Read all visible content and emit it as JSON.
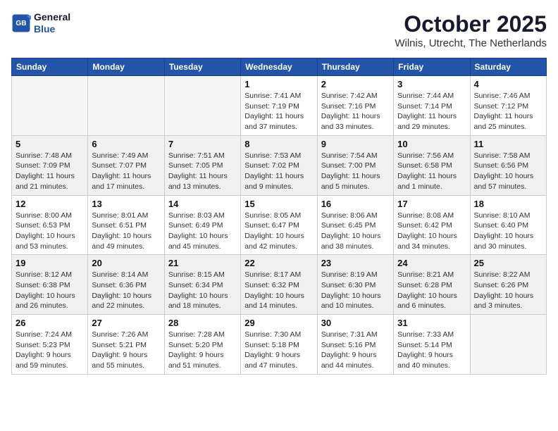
{
  "header": {
    "logo": {
      "line1": "General",
      "line2": "Blue"
    },
    "title": "October 2025",
    "location": "Wilnis, Utrecht, The Netherlands"
  },
  "weekdays": [
    "Sunday",
    "Monday",
    "Tuesday",
    "Wednesday",
    "Thursday",
    "Friday",
    "Saturday"
  ],
  "weeks": [
    [
      {
        "day": "",
        "info": ""
      },
      {
        "day": "",
        "info": ""
      },
      {
        "day": "",
        "info": ""
      },
      {
        "day": "1",
        "info": "Sunrise: 7:41 AM\nSunset: 7:19 PM\nDaylight: 11 hours\nand 37 minutes."
      },
      {
        "day": "2",
        "info": "Sunrise: 7:42 AM\nSunset: 7:16 PM\nDaylight: 11 hours\nand 33 minutes."
      },
      {
        "day": "3",
        "info": "Sunrise: 7:44 AM\nSunset: 7:14 PM\nDaylight: 11 hours\nand 29 minutes."
      },
      {
        "day": "4",
        "info": "Sunrise: 7:46 AM\nSunset: 7:12 PM\nDaylight: 11 hours\nand 25 minutes."
      }
    ],
    [
      {
        "day": "5",
        "info": "Sunrise: 7:48 AM\nSunset: 7:09 PM\nDaylight: 11 hours\nand 21 minutes."
      },
      {
        "day": "6",
        "info": "Sunrise: 7:49 AM\nSunset: 7:07 PM\nDaylight: 11 hours\nand 17 minutes."
      },
      {
        "day": "7",
        "info": "Sunrise: 7:51 AM\nSunset: 7:05 PM\nDaylight: 11 hours\nand 13 minutes."
      },
      {
        "day": "8",
        "info": "Sunrise: 7:53 AM\nSunset: 7:02 PM\nDaylight: 11 hours\nand 9 minutes."
      },
      {
        "day": "9",
        "info": "Sunrise: 7:54 AM\nSunset: 7:00 PM\nDaylight: 11 hours\nand 5 minutes."
      },
      {
        "day": "10",
        "info": "Sunrise: 7:56 AM\nSunset: 6:58 PM\nDaylight: 11 hours\nand 1 minute."
      },
      {
        "day": "11",
        "info": "Sunrise: 7:58 AM\nSunset: 6:56 PM\nDaylight: 10 hours\nand 57 minutes."
      }
    ],
    [
      {
        "day": "12",
        "info": "Sunrise: 8:00 AM\nSunset: 6:53 PM\nDaylight: 10 hours\nand 53 minutes."
      },
      {
        "day": "13",
        "info": "Sunrise: 8:01 AM\nSunset: 6:51 PM\nDaylight: 10 hours\nand 49 minutes."
      },
      {
        "day": "14",
        "info": "Sunrise: 8:03 AM\nSunset: 6:49 PM\nDaylight: 10 hours\nand 45 minutes."
      },
      {
        "day": "15",
        "info": "Sunrise: 8:05 AM\nSunset: 6:47 PM\nDaylight: 10 hours\nand 42 minutes."
      },
      {
        "day": "16",
        "info": "Sunrise: 8:06 AM\nSunset: 6:45 PM\nDaylight: 10 hours\nand 38 minutes."
      },
      {
        "day": "17",
        "info": "Sunrise: 8:08 AM\nSunset: 6:42 PM\nDaylight: 10 hours\nand 34 minutes."
      },
      {
        "day": "18",
        "info": "Sunrise: 8:10 AM\nSunset: 6:40 PM\nDaylight: 10 hours\nand 30 minutes."
      }
    ],
    [
      {
        "day": "19",
        "info": "Sunrise: 8:12 AM\nSunset: 6:38 PM\nDaylight: 10 hours\nand 26 minutes."
      },
      {
        "day": "20",
        "info": "Sunrise: 8:14 AM\nSunset: 6:36 PM\nDaylight: 10 hours\nand 22 minutes."
      },
      {
        "day": "21",
        "info": "Sunrise: 8:15 AM\nSunset: 6:34 PM\nDaylight: 10 hours\nand 18 minutes."
      },
      {
        "day": "22",
        "info": "Sunrise: 8:17 AM\nSunset: 6:32 PM\nDaylight: 10 hours\nand 14 minutes."
      },
      {
        "day": "23",
        "info": "Sunrise: 8:19 AM\nSunset: 6:30 PM\nDaylight: 10 hours\nand 10 minutes."
      },
      {
        "day": "24",
        "info": "Sunrise: 8:21 AM\nSunset: 6:28 PM\nDaylight: 10 hours\nand 6 minutes."
      },
      {
        "day": "25",
        "info": "Sunrise: 8:22 AM\nSunset: 6:26 PM\nDaylight: 10 hours\nand 3 minutes."
      }
    ],
    [
      {
        "day": "26",
        "info": "Sunrise: 7:24 AM\nSunset: 5:23 PM\nDaylight: 9 hours\nand 59 minutes."
      },
      {
        "day": "27",
        "info": "Sunrise: 7:26 AM\nSunset: 5:21 PM\nDaylight: 9 hours\nand 55 minutes."
      },
      {
        "day": "28",
        "info": "Sunrise: 7:28 AM\nSunset: 5:20 PM\nDaylight: 9 hours\nand 51 minutes."
      },
      {
        "day": "29",
        "info": "Sunrise: 7:30 AM\nSunset: 5:18 PM\nDaylight: 9 hours\nand 47 minutes."
      },
      {
        "day": "30",
        "info": "Sunrise: 7:31 AM\nSunset: 5:16 PM\nDaylight: 9 hours\nand 44 minutes."
      },
      {
        "day": "31",
        "info": "Sunrise: 7:33 AM\nSunset: 5:14 PM\nDaylight: 9 hours\nand 40 minutes."
      },
      {
        "day": "",
        "info": ""
      }
    ]
  ]
}
